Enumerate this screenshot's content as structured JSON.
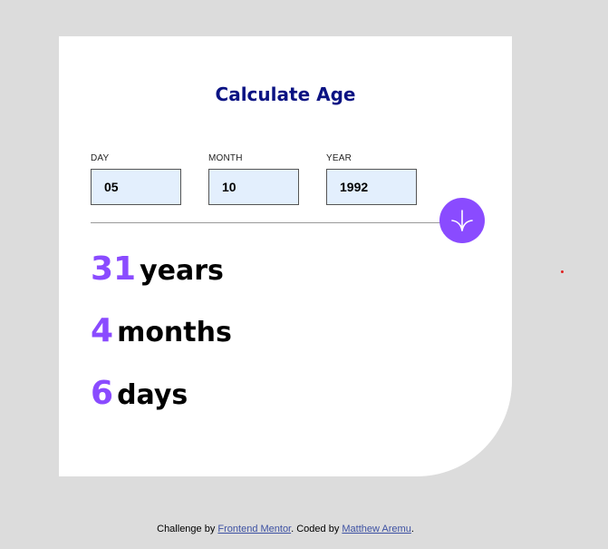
{
  "app": {
    "title": "Calculate Age"
  },
  "form": {
    "day": {
      "label": "DAY",
      "value": "05"
    },
    "month": {
      "label": "MONTH",
      "value": "10"
    },
    "year": {
      "label": "YEAR",
      "value": "1992"
    }
  },
  "submit": {
    "icon": "arrow-down-icon",
    "color": "#8a4bff"
  },
  "results": {
    "years": {
      "value": "31",
      "unit": "years"
    },
    "months": {
      "value": "4",
      "unit": "months"
    },
    "days": {
      "value": "6",
      "unit": "days"
    }
  },
  "footer": {
    "prefix": "Challenge by ",
    "challenge_link": "Frontend Mentor",
    "middle": ". Coded by ",
    "author_link": "Matthew Aremu",
    "suffix": "."
  },
  "colors": {
    "accent": "#8a4bff",
    "title": "#0b1383",
    "input_bg": "#e3effd",
    "background": "#dcdcdc"
  }
}
